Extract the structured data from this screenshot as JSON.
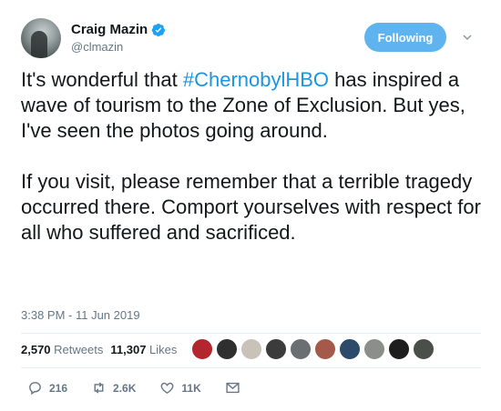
{
  "author": {
    "name": "Craig Mazin",
    "handle": "@clmazin"
  },
  "follow_button": "Following",
  "tweet": {
    "pre_hashtag": "It's wonderful that ",
    "hashtag": "#ChernobylHBO",
    "post_hashtag": " has inspired a wave of tourism to the Zone of Exclusion. But yes, I've seen the photos going around.\n\nIf you visit, please remember that a terrible tragedy occurred there. Comport yourselves with respect for all who suffered and sacrificed."
  },
  "timestamp": "3:38 PM - 11 Jun 2019",
  "stats": {
    "retweets_count": "2,570",
    "retweets_label": "Retweets",
    "likes_count": "11,307",
    "likes_label": "Likes"
  },
  "liker_avatars": [
    "#b3262e",
    "#2f2f2f",
    "#c9c2b8",
    "#3b3b3b",
    "#6b6f72",
    "#a35a4a",
    "#2d4a6b",
    "#8b8f8a",
    "#1e1e1e",
    "#4a4f4c"
  ],
  "actions": {
    "replies": "216",
    "retweets": "2.6K",
    "likes": "11K"
  },
  "colors": {
    "accent": "#1b95e0",
    "follow_bg": "#5fb3ef",
    "muted": "#657786"
  }
}
